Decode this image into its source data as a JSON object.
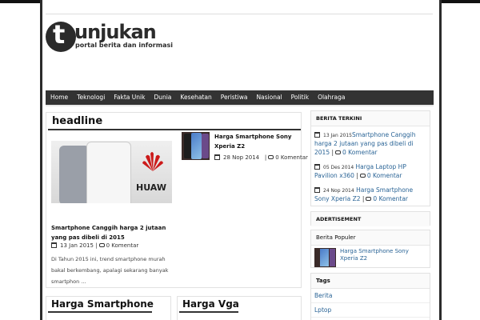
{
  "site": {
    "logo_letter": "t",
    "logo_word": "unjukan",
    "tagline": "portal berita dan informasi"
  },
  "nav": {
    "items": [
      "Home",
      "Teknologi",
      "Fakta Unik",
      "Dunia",
      "Kesehatan",
      "Peristiwa",
      "Nasional",
      "Politik",
      "Olahraga"
    ]
  },
  "headline": {
    "title": "headline",
    "featured": {
      "title": "Smartphone Canggih harga 2 jutaan yang pas dibeli di 2015",
      "date": "13 Jan 2015",
      "comments": "0 Komentar",
      "excerpt": "Di Tahun 2015 ini, trend smartphone murah bakal berkembang, apalagi sekarang banyak smartphon ...",
      "image_text": "HUAW"
    },
    "secondary": {
      "title": "Harga Smartphone Sony Xperia Z2",
      "date": "28 Nop 2014",
      "comments": "0 Komentar"
    }
  },
  "sections": {
    "left": "Harga Smartphone",
    "right": "Harga Vga"
  },
  "sidebar": {
    "terkini": {
      "heading": "BERITA TERKINI",
      "items": [
        {
          "date": "13 Jan 2015",
          "title": "Smartphone Canggih harga 2 jutaan yang pas dibeli di 2015",
          "comments": "0 Komentar"
        },
        {
          "date": "05 Des 2014",
          "title": "Harga Laptop HP Pavilion x360",
          "comments": "0 Komentar"
        },
        {
          "date": "24 Nop 2014",
          "title": "Harga Smartphone Sony Xperia Z2",
          "comments": "0 Komentar"
        }
      ]
    },
    "advertisement": {
      "heading": "ADERTISEMENT"
    },
    "populer": {
      "heading": "Berita Populer",
      "item": "Harga Smartphone Sony Xperia Z2"
    },
    "tags": {
      "heading": "Tags",
      "items": [
        "Berita",
        "Lptop"
      ]
    }
  },
  "colors": {
    "nav_bg": "#333333",
    "link": "#2a6496",
    "huawei_red": "#cc1b1b"
  }
}
